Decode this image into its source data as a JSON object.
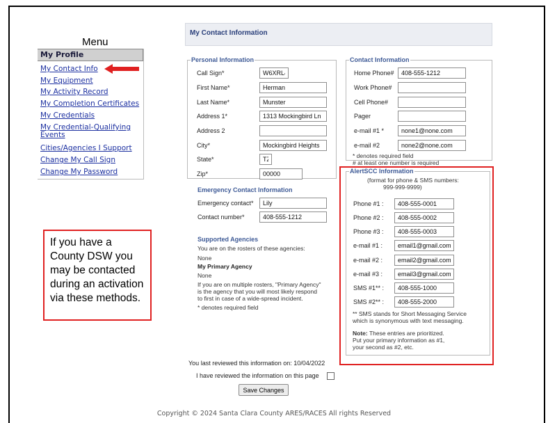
{
  "menu": {
    "caption": "Menu",
    "heading": "My Profile",
    "items": [
      "My Contact Info",
      "My Equipment",
      "My Activity Record",
      "My Completion Certificates",
      "My Credentials",
      "My Credential-Qualifying",
      "Events",
      "Cities/Agencies I Support",
      "Change My Call Sign",
      "Change My Password"
    ]
  },
  "callout": "If you have a County DSW you may be contacted during an activation via these methods.",
  "page": {
    "title": "My Contact Information"
  },
  "personal": {
    "legend": "Personal Information",
    "fields": [
      {
        "label": "Call Sign*",
        "value": "W6XRL4"
      },
      {
        "label": "First Name*",
        "value": "Herman"
      },
      {
        "label": "Last Name*",
        "value": "Munster"
      },
      {
        "label": "Address 1*",
        "value": "1313 Mockingbird Ln"
      },
      {
        "label": "Address 2",
        "value": ""
      },
      {
        "label": "City*",
        "value": "Mockingbird Heights"
      },
      {
        "label": "State*",
        "value": "TZ"
      },
      {
        "label": "Zip*",
        "value": "00000"
      }
    ]
  },
  "emergency": {
    "title": "Emergency Contact Information",
    "fields": [
      {
        "label": "Emergency contact*",
        "value": "Lily"
      },
      {
        "label": "Contact number*",
        "value": "408-555-1212"
      }
    ]
  },
  "agencies": {
    "title": "Supported Agencies",
    "rosters_text": "You are on the rosters of these agencies:",
    "rosters_value": "None",
    "primary_title": "My Primary Agency",
    "primary_value": "None",
    "note": [
      "If you are on multiple rosters, \"Primary Agency\"",
      "is the agency that you will most likely respond",
      "to first in case of a wide-spread incident."
    ],
    "required": "* denotes required field"
  },
  "contact": {
    "legend": "Contact Information",
    "fields": [
      {
        "label": "Home Phone#",
        "value": "408-555-1212"
      },
      {
        "label": "Work Phone#",
        "value": ""
      },
      {
        "label": "Cell Phone#",
        "value": ""
      },
      {
        "label": "Pager",
        "value": ""
      },
      {
        "label": "e-mail #1 *",
        "value": "none1@none.com"
      },
      {
        "label": "e-mail #2",
        "value": "none2@none.com"
      }
    ],
    "note1": "* denotes required field",
    "note2": "# at least one number is required"
  },
  "alert": {
    "legend": "AlertSCC Information",
    "format_line1": "(format for phone & SMS numbers:",
    "format_line2": "999-999-9999)",
    "fields": [
      {
        "label": "Phone #1 :",
        "value": "408-555-0001"
      },
      {
        "label": "Phone #2 :",
        "value": "408-555-0002"
      },
      {
        "label": "Phone #3 :",
        "value": "408-555-0003"
      },
      {
        "label": "e-mail #1 :",
        "value": "email1@gmail.com"
      },
      {
        "label": "e-mail #2 :",
        "value": "email2@gmail.com"
      },
      {
        "label": "e-mail #3 :",
        "value": "email3@gmail.com"
      },
      {
        "label": "SMS #1** :",
        "value": "408-555-1000"
      },
      {
        "label": "SMS #2** :",
        "value": "408-555-2000"
      }
    ],
    "sms_note1": "** SMS stands for Short Messaging Service",
    "sms_note2": "which is synonymous with text messaging.",
    "note_label": "Note:",
    "note_text1": " These entries are prioritized.",
    "note_text2": "Put your primary information as #1,",
    "note_text3": "your second as #2, etc."
  },
  "review": {
    "last_reviewed": "You last reviewed this information on: 10/04/2022",
    "checkbox_label": "I have reviewed the information on this page",
    "save_label": "Save Changes"
  },
  "footer": "Copyright © 2024 Santa Clara County ARES/RACES All rights Reserved"
}
